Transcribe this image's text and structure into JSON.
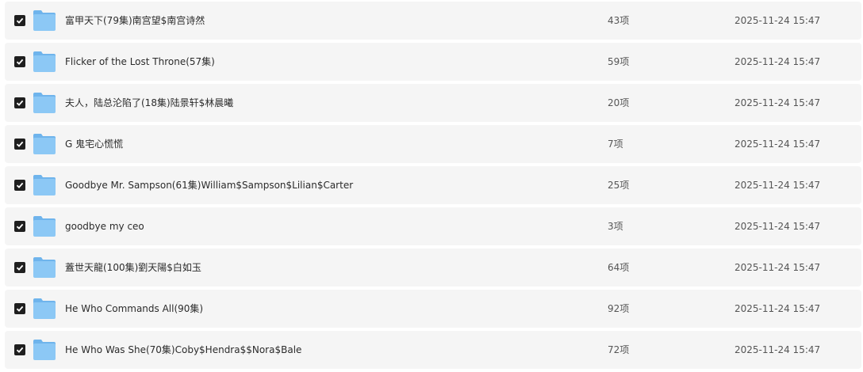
{
  "files": [
    {
      "name": "富甲天下(79集)南宫望$南宫诗然",
      "count": "43项",
      "date": "2025-11-24 15:47",
      "checked": true
    },
    {
      "name": "Flicker of the Lost Throne(57集)",
      "count": "59项",
      "date": "2025-11-24 15:47",
      "checked": true
    },
    {
      "name": "夫人，陆总沦陷了(18集)陆景轩$林晨曦",
      "count": "20项",
      "date": "2025-11-24 15:47",
      "checked": true
    },
    {
      "name": "G 鬼宅心慌慌",
      "count": "7项",
      "date": "2025-11-24 15:47",
      "checked": true
    },
    {
      "name": "Goodbye Mr. Sampson(61集)William$Sampson$Lilian$Carter",
      "count": "25项",
      "date": "2025-11-24 15:47",
      "checked": true
    },
    {
      "name": "goodbye my ceo",
      "count": "3项",
      "date": "2025-11-24 15:47",
      "checked": true
    },
    {
      "name": "蓋世天龍(100集)劉天陽$白如玉",
      "count": "64项",
      "date": "2025-11-24 15:47",
      "checked": true
    },
    {
      "name": "He Who Commands All(90集)",
      "count": "92项",
      "date": "2025-11-24 15:47",
      "checked": true
    },
    {
      "name": "He Who Was She(70集)Coby$Hendra$$Nora$Bale",
      "count": "72项",
      "date": "2025-11-24 15:47",
      "checked": true
    }
  ],
  "colors": {
    "row_bg": "#f5f5f5",
    "checkbox": "#1f1f1f",
    "folder_front": "#8cc8f5",
    "folder_back": "#6fb4ec"
  },
  "icons": {
    "checkbox": "checkbox-checked-icon",
    "folder": "folder-icon"
  }
}
